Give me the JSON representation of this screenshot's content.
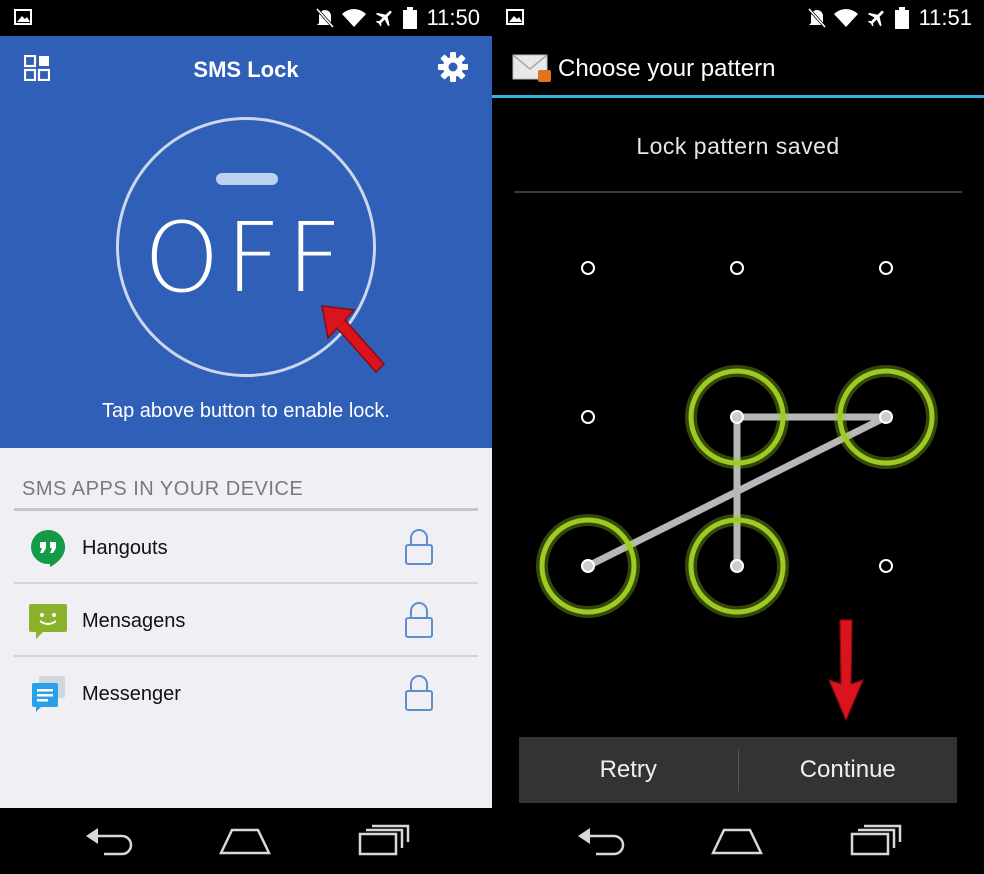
{
  "left": {
    "status_time": "11:50",
    "app_title": "SMS Lock",
    "toggle_state": "OFF",
    "tap_hint": "Tap above button to enable lock.",
    "section_header": "SMS APPS IN YOUR DEVICE",
    "apps": [
      {
        "name": "Hangouts",
        "icon": "hangouts-icon"
      },
      {
        "name": "Mensagens",
        "icon": "mensagens-icon"
      },
      {
        "name": "Messenger",
        "icon": "messenger-icon"
      }
    ],
    "colors": {
      "header": "#2f5fb6",
      "list_bg": "#f0f0f4",
      "lock": "#5b8fcf"
    }
  },
  "right": {
    "status_time": "11:51",
    "dialog_title": "Choose your pattern",
    "pattern_status": "Lock pattern saved",
    "pattern_path": [
      7,
      4,
      5,
      6
    ],
    "buttons": {
      "retry": "Retry",
      "continue": "Continue"
    },
    "colors": {
      "accent": "#33b5e5",
      "pattern_ring": "#9ccc22",
      "button_bar": "#333333"
    }
  },
  "icons": {
    "status": [
      "picture-icon",
      "mute-icon",
      "wifi-icon",
      "airplane-icon",
      "battery-icon"
    ],
    "nav": [
      "back-icon",
      "home-icon",
      "recents-icon"
    ]
  }
}
